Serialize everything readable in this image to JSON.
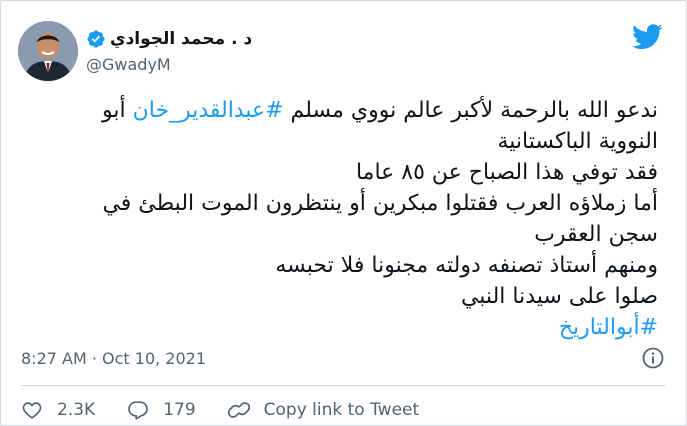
{
  "tweet": {
    "display_name": "د . محمد الجوادي",
    "handle": "@GwadyM",
    "lines": [
      [
        {
          "text": "ندعو الله بالرحمة لأكبر عالم نووي مسلم ",
          "hashtag": false
        },
        {
          "text": "#عبدالقدير_خان",
          "hashtag": true
        },
        {
          "text": " أبو",
          "hashtag": false
        }
      ],
      [
        {
          "text": "النووية الباكستانية",
          "hashtag": false
        }
      ],
      [
        {
          "text": "فقد توفي هذا الصباح  عن ٨٥ عاما",
          "hashtag": false
        }
      ],
      [
        {
          "text": "أما زملاؤه العرب فقتلوا مبكرين أو ينتظرون الموت البطئ في",
          "hashtag": false
        }
      ],
      [
        {
          "text": "سجن العقرب",
          "hashtag": false
        }
      ],
      [
        {
          "text": "ومنهم أستاذ تصنفه دولته مجنونا فلا تحبسه",
          "hashtag": false
        }
      ],
      [
        {
          "text": "صلوا على سيدنا النبي",
          "hashtag": false
        }
      ],
      [
        {
          "text": "#أبوالتاريخ",
          "hashtag": true
        }
      ]
    ],
    "timestamp": "8:27 AM · Oct 10, 2021"
  },
  "actions": {
    "likes": "2.3K",
    "replies": "179",
    "copy_link": "Copy link to Tweet"
  },
  "icons": {
    "brand": "twitter-bird-icon",
    "verified": "verified-badge-icon",
    "info": "info-icon",
    "like": "heart-icon",
    "reply": "reply-icon",
    "link": "link-icon"
  },
  "colors": {
    "brand_blue": "#1d9bf0",
    "like_red": "#f91880",
    "muted": "#536471",
    "text": "#0f1419"
  }
}
